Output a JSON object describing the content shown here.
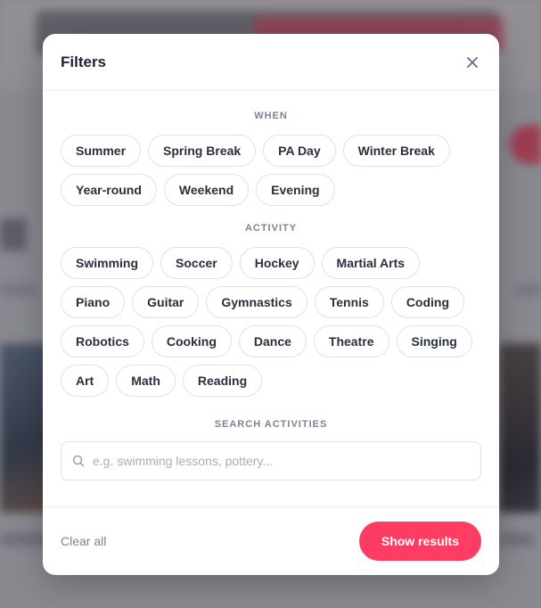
{
  "modal": {
    "title": "Filters",
    "close_icon": "close-icon"
  },
  "when": {
    "heading": "WHEN",
    "options": [
      "Summer",
      "Spring Break",
      "PA Day",
      "Winter Break",
      "Year-round",
      "Weekend",
      "Evening"
    ]
  },
  "activity": {
    "heading": "ACTIVITY",
    "options": [
      "Swimming",
      "Soccer",
      "Hockey",
      "Martial Arts",
      "Piano",
      "Guitar",
      "Gymnastics",
      "Tennis",
      "Coding",
      "Robotics",
      "Cooking",
      "Dance",
      "Theatre",
      "Singing",
      "Art",
      "Math",
      "Reading"
    ]
  },
  "search": {
    "heading": "SEARCH ACTIVITIES",
    "placeholder": "e.g. swimming lessons, pottery...",
    "value": "",
    "icon": "search-icon"
  },
  "footer": {
    "clear_label": "Clear all",
    "submit_label": "Show results"
  },
  "colors": {
    "accent": "#ff3d63",
    "text": "#1d2233",
    "muted": "#7d8393"
  }
}
